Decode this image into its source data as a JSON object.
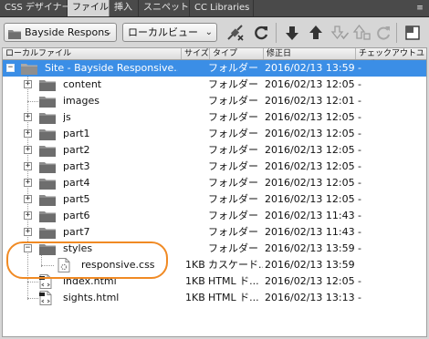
{
  "tabs": [
    {
      "label": "CSS デザイナー",
      "active": false
    },
    {
      "label": "ファイル",
      "active": true
    },
    {
      "label": "挿入",
      "active": false
    },
    {
      "label": "スニペット",
      "active": false
    },
    {
      "label": "CC Libraries",
      "active": false
    }
  ],
  "toolbar": {
    "site_select": "Bayside Respons",
    "view_select": "ローカルビュー",
    "icons": [
      "disconnect-icon",
      "refresh-icon",
      "get-icon",
      "put-icon",
      "check-out-icon",
      "check-in-icon",
      "sync-icon",
      "expand-icon"
    ]
  },
  "columns": {
    "name": "ローカルファイル",
    "size": "サイズ",
    "type": "タイプ",
    "modified": "修正日",
    "checkout": "チェックアウトユーザー"
  },
  "rows": [
    {
      "name": "Site - Bayside Responsive...",
      "size": "",
      "type": "フォルダー",
      "date": "2016/02/13 13:59",
      "checkout": "-",
      "kind": "folder",
      "depth": 0,
      "expander": "−",
      "selected": true
    },
    {
      "name": "content",
      "size": "",
      "type": "フォルダー",
      "date": "2016/02/13 12:05",
      "checkout": "-",
      "kind": "folder",
      "depth": 1,
      "expander": "+",
      "selected": false
    },
    {
      "name": "images",
      "size": "",
      "type": "フォルダー",
      "date": "2016/02/13 12:01",
      "checkout": "-",
      "kind": "folder",
      "depth": 1,
      "expander": "",
      "selected": false
    },
    {
      "name": "js",
      "size": "",
      "type": "フォルダー",
      "date": "2016/02/13 12:05",
      "checkout": "-",
      "kind": "folder",
      "depth": 1,
      "expander": "+",
      "selected": false
    },
    {
      "name": "part1",
      "size": "",
      "type": "フォルダー",
      "date": "2016/02/13 12:05",
      "checkout": "-",
      "kind": "folder",
      "depth": 1,
      "expander": "+",
      "selected": false
    },
    {
      "name": "part2",
      "size": "",
      "type": "フォルダー",
      "date": "2016/02/13 12:05",
      "checkout": "-",
      "kind": "folder",
      "depth": 1,
      "expander": "+",
      "selected": false
    },
    {
      "name": "part3",
      "size": "",
      "type": "フォルダー",
      "date": "2016/02/13 12:05",
      "checkout": "-",
      "kind": "folder",
      "depth": 1,
      "expander": "+",
      "selected": false
    },
    {
      "name": "part4",
      "size": "",
      "type": "フォルダー",
      "date": "2016/02/13 12:05",
      "checkout": "-",
      "kind": "folder",
      "depth": 1,
      "expander": "+",
      "selected": false
    },
    {
      "name": "part5",
      "size": "",
      "type": "フォルダー",
      "date": "2016/02/13 12:05",
      "checkout": "-",
      "kind": "folder",
      "depth": 1,
      "expander": "+",
      "selected": false
    },
    {
      "name": "part6",
      "size": "",
      "type": "フォルダー",
      "date": "2016/02/13 11:43",
      "checkout": "-",
      "kind": "folder",
      "depth": 1,
      "expander": "+",
      "selected": false
    },
    {
      "name": "part7",
      "size": "",
      "type": "フォルダー",
      "date": "2016/02/13 11:43",
      "checkout": "-",
      "kind": "folder",
      "depth": 1,
      "expander": "+",
      "selected": false
    },
    {
      "name": "styles",
      "size": "",
      "type": "フォルダー",
      "date": "2016/02/13 13:59",
      "checkout": "-",
      "kind": "folder",
      "depth": 1,
      "expander": "−",
      "selected": false
    },
    {
      "name": "responsive.css",
      "size": "1KB",
      "type": "カスケード...",
      "date": "2016/02/13 13:59",
      "checkout": "",
      "kind": "css",
      "depth": 2,
      "expander": "",
      "selected": false
    },
    {
      "name": "index.html",
      "size": "1KB",
      "type": "HTML ド...",
      "date": "2016/02/13 12:05",
      "checkout": "-",
      "kind": "html",
      "depth": 1,
      "expander": "",
      "selected": false
    },
    {
      "name": "sights.html",
      "size": "1KB",
      "type": "HTML ド...",
      "date": "2016/02/13 13:13",
      "checkout": "-",
      "kind": "html",
      "depth": 1,
      "expander": "",
      "selected": false
    }
  ],
  "colors": {
    "selection": "#3b8ee6",
    "highlight_ring": "#f08a24",
    "tab_bar": "#4a4a4a"
  }
}
